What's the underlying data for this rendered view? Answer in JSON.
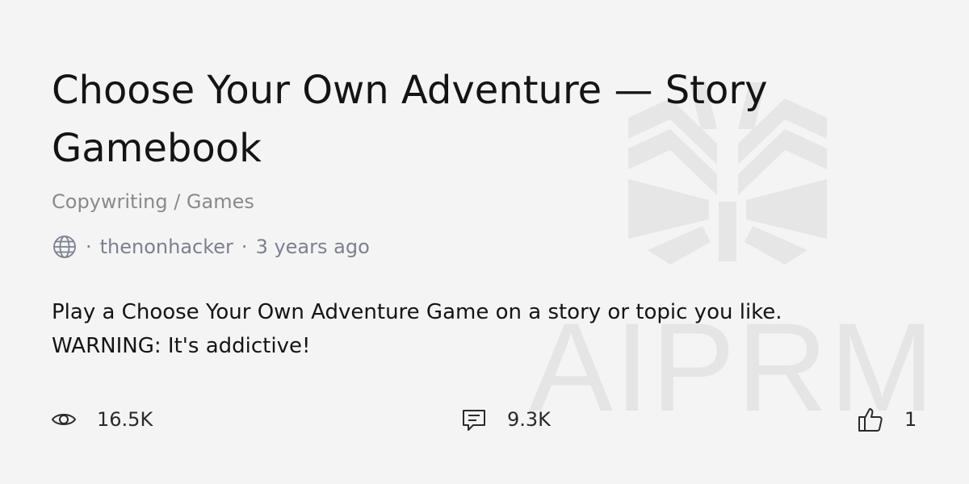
{
  "prompt": {
    "title": "Choose Your Own Adventure — Story Gamebook",
    "category": "Copywriting / Games",
    "author": "thenonhacker",
    "age": "3 years ago",
    "description": "Play a Choose Your Own Adventure Game on a story or topic you like. WARNING: It's addictive!"
  },
  "meta": {
    "visibility_icon": "globe-icon",
    "separator": "·"
  },
  "stats": {
    "views": "16.5K",
    "views_icon": "eye-icon",
    "comments": "9.3K",
    "comments_icon": "comment-icon",
    "likes": "1",
    "likes_icon": "thumbs-up-icon"
  },
  "watermark": {
    "text": "AIPRM",
    "logo_icon": "aiprm-logo-icon"
  },
  "colors": {
    "background": "#f4f4f4",
    "text": "#141414",
    "muted": "#8a8a8a",
    "meta": "#7a8190",
    "watermark": "#e5e5e5"
  }
}
